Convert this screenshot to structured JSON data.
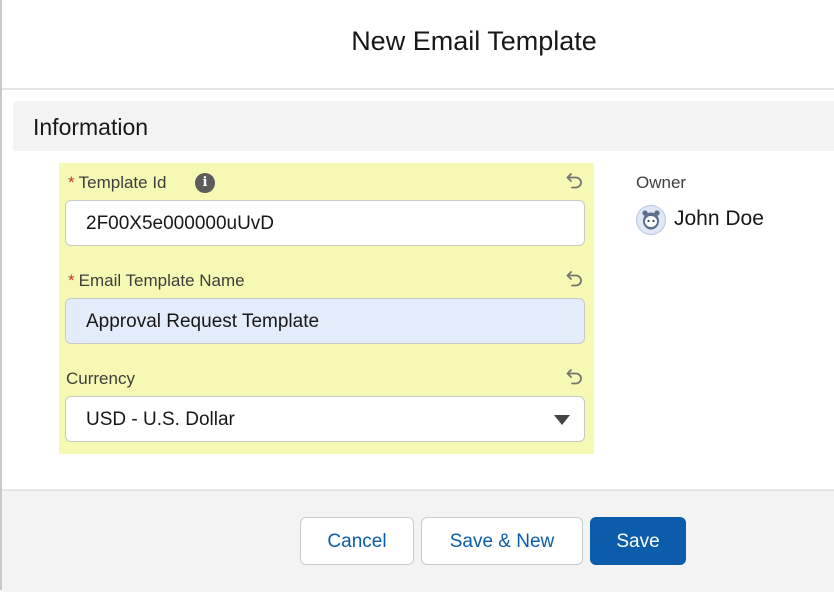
{
  "modal": {
    "title": "New Email Template"
  },
  "section": {
    "title": "Information"
  },
  "fields": {
    "template_id": {
      "label": "Template Id",
      "required_marker": "*",
      "value": "2F00X5e000000uUvD"
    },
    "template_name": {
      "label": "Email Template Name",
      "required_marker": "*",
      "value": "Approval Request Template"
    },
    "currency": {
      "label": "Currency",
      "value": "USD - U.S. Dollar"
    }
  },
  "owner": {
    "label": "Owner",
    "name": "John Doe"
  },
  "buttons": {
    "cancel": "Cancel",
    "save_new": "Save & New",
    "save": "Save"
  },
  "colors": {
    "brand": "#0b5cab",
    "highlight": "#f6f9b4",
    "required": "#c23934",
    "focus_fill": "#e3ecfa"
  },
  "icons": {
    "info": "info-icon",
    "undo": "undo-icon",
    "caret": "chevron-down-icon",
    "avatar": "user-avatar"
  }
}
